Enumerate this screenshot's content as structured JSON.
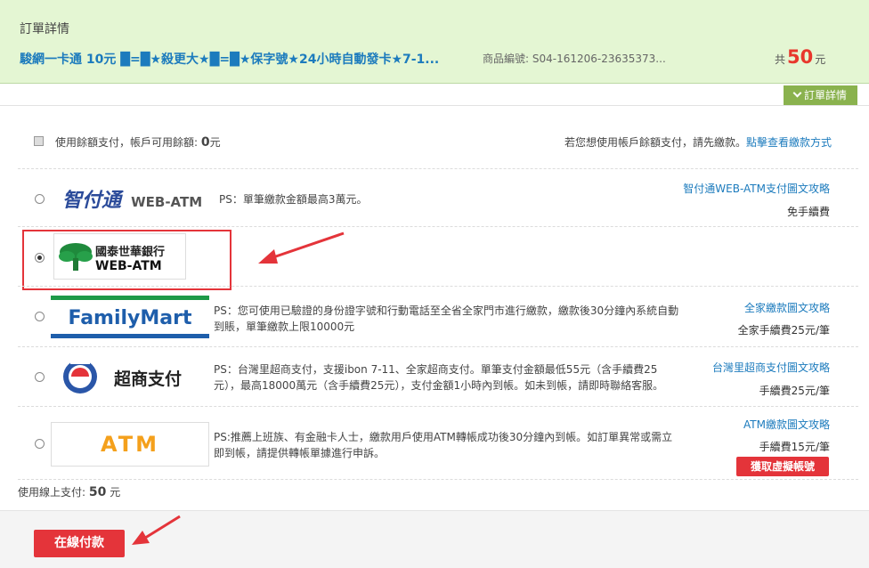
{
  "header": {
    "title": "訂單詳情",
    "product_name": "駿網一卡通 10元 █=█★殺更大★█=█★保字號★24小時自動發卡★7-1...",
    "product_id_label": "商品編號:",
    "product_id": "S04-161206-23635373...",
    "total_prefix": "共",
    "total_amount": "50",
    "total_suffix": "元",
    "detail_toggle": "訂單詳情"
  },
  "balance": {
    "label": "使用餘額支付，帳戶可用餘額:",
    "value": "0",
    "unit": "元",
    "hint": "若您想使用帳戶餘額支付，請先繳款。",
    "hint_link": "點擊查看繳款方式"
  },
  "methods": [
    {
      "key": "smartpay",
      "logo_text": "智付通",
      "logo_sub": "WEB-ATM",
      "ps": "PS：單筆繳款金額最高3萬元。",
      "guide": "智付通WEB-ATM支付圖文攻略",
      "fee": "免手續費",
      "selected": false
    },
    {
      "key": "cathay",
      "logo_text": "國泰世華銀行",
      "logo_sub": "WEB-ATM",
      "ps": "",
      "guide": "",
      "fee": "",
      "selected": true
    },
    {
      "key": "familymart",
      "logo_text": "FamilyMart",
      "ps": "PS：您可使用已驗證的身份證字號和行動電話至全省全家門市進行繳款，繳款後30分鐘內系統自動到賬，單筆繳款上限10000元",
      "guide": "全家繳款圖文攻略",
      "fee": "全家手續費25元/筆",
      "selected": false
    },
    {
      "key": "store",
      "logo_text": "超商支付",
      "ps": "PS：台灣里超商支付，支援ibon 7-11、全家超商支付。單筆支付金額最低55元（含手續費25元），最高18000萬元（含手續費25元），支付金額1小時內到帳。如未到帳，請即時聯絡客服。",
      "guide": "台灣里超商支付圖文攻略",
      "fee": "手續費25元/筆",
      "selected": false
    },
    {
      "key": "atm",
      "logo_text": "ATM",
      "ps": "PS:推薦上班族、有金融卡人士，繳款用戶使用ATM轉帳成功後30分鐘內到帳。如訂單異常或需立即到帳，請提供轉帳單據進行申訴。",
      "guide": "ATM繳款圖文攻略",
      "fee": "手續費15元/筆",
      "action": "獲取虛擬帳號",
      "selected": false
    }
  ],
  "online": {
    "label": "使用線上支付:",
    "value": "50",
    "unit": "元"
  },
  "pay_button": "在線付款",
  "colors": {
    "accent_red": "#e4343a",
    "link_blue": "#1c7bbd",
    "header_green": "#e4f6d3",
    "toggle_green": "#8ab24e"
  }
}
